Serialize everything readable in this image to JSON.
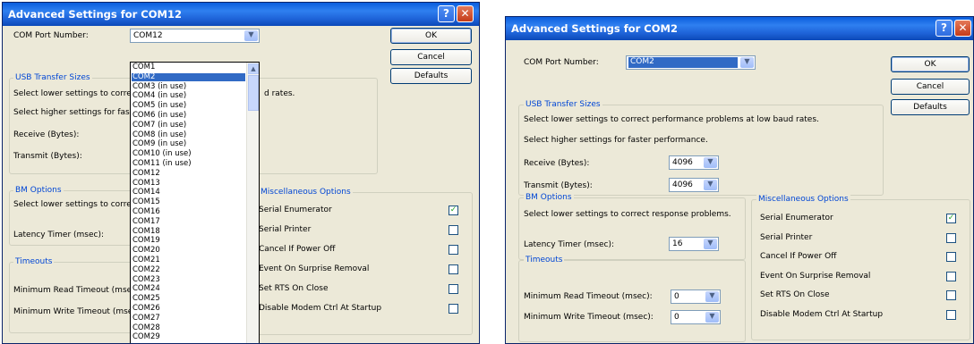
{
  "left": {
    "title": "Advanced Settings for COM12",
    "help_glyph": "?",
    "close_glyph": "✕",
    "com_port_label": "COM Port Number:",
    "com_port_value": "COM12",
    "usb_group": "USB Transfer Sizes",
    "select_lower": "Select lower settings to corre",
    "baud_tail": "d rates.",
    "select_higher": "Select higher settings for fas",
    "receive_label": "Receive (Bytes):",
    "transmit_label": "Transmit (Bytes):",
    "bm_group": "BM Options",
    "bm_select_lower": "Select lower settings to corre",
    "latency_label": "Latency Timer (msec):",
    "timeouts_group": "Timeouts",
    "min_read": "Minimum Read Timeout (mse",
    "min_write": "Minimum Write Timeout (mse",
    "misc_group": "Miscellaneous Options",
    "misc": [
      "Serial Enumerator",
      "Serial Printer",
      "Cancel If Power Off",
      "Event On Surprise Removal",
      "Set RTS On Close",
      "Disable Modem Ctrl At Startup"
    ],
    "misc_checked": [
      true,
      false,
      false,
      false,
      false,
      false
    ],
    "ok": "OK",
    "cancel": "Cancel",
    "defaults": "Defaults",
    "dropdown_items": [
      "COM1",
      "COM2",
      "COM3 (in use)",
      "COM4 (in use)",
      "COM5 (in use)",
      "COM6 (in use)",
      "COM7 (in use)",
      "COM8 (in use)",
      "COM9 (in use)",
      "COM10 (in use)",
      "COM11 (in use)",
      "COM12",
      "COM13",
      "COM14",
      "COM15",
      "COM16",
      "COM17",
      "COM18",
      "COM19",
      "COM20",
      "COM21",
      "COM22",
      "COM23",
      "COM24",
      "COM25",
      "COM26",
      "COM27",
      "COM28",
      "COM29"
    ],
    "dropdown_selected": "COM2"
  },
  "right": {
    "title": "Advanced Settings for COM2",
    "help_glyph": "?",
    "close_glyph": "✕",
    "com_port_label": "COM Port Number:",
    "com_port_value": "COM2",
    "usb_group": "USB Transfer Sizes",
    "select_lower": "Select lower settings to correct performance problems at low baud rates.",
    "select_higher": "Select higher settings for faster performance.",
    "receive_label": "Receive (Bytes):",
    "receive_value": "4096",
    "transmit_label": "Transmit (Bytes):",
    "transmit_value": "4096",
    "bm_group": "BM Options",
    "bm_select_lower": "Select lower settings to correct response problems.",
    "latency_label": "Latency Timer (msec):",
    "latency_value": "16",
    "timeouts_group": "Timeouts",
    "min_read": "Minimum Read Timeout (msec):",
    "min_read_value": "0",
    "min_write": "Minimum Write Timeout (msec):",
    "min_write_value": "0",
    "misc_group": "Miscellaneous Options",
    "misc": [
      "Serial Enumerator",
      "Serial Printer",
      "Cancel If Power Off",
      "Event On Surprise Removal",
      "Set RTS On Close",
      "Disable Modem Ctrl At Startup"
    ],
    "misc_checked": [
      true,
      false,
      false,
      false,
      false,
      false
    ],
    "ok": "OK",
    "cancel": "Cancel",
    "defaults": "Defaults"
  },
  "colors": {
    "title_blue": "#0a5ddc",
    "dialog_bg": "#ece9d8",
    "group_text": "#0046d5",
    "selection": "#316ac5",
    "check_green": "#21a121"
  }
}
